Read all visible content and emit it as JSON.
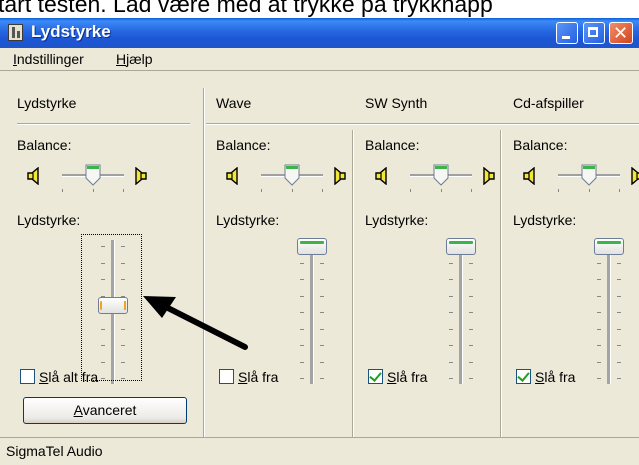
{
  "header_text": "tart testen. Lad være med at trykke på trykknapp",
  "window": {
    "title": "Lydstyrke",
    "controls": [
      "minimize",
      "maximize",
      "close"
    ]
  },
  "menu": {
    "items": [
      "Indstillinger",
      "Hjælp"
    ]
  },
  "master": {
    "header": "Lydstyrke",
    "balance_label": "Balance:",
    "volume_label": "Lydstyrke:",
    "mute_label": "Slå alt fra",
    "muted": false,
    "balance": 0.5,
    "volume": 0.6,
    "advanced_label": "Avanceret"
  },
  "channels": [
    {
      "name": "Wave",
      "balance_label": "Balance:",
      "volume_label": "Lydstyrke:",
      "mute_label": "Slå fra",
      "muted": false,
      "balance": 0.5,
      "volume": 1.0
    },
    {
      "name": "SW Synth",
      "balance_label": "Balance:",
      "volume_label": "Lydstyrke:",
      "mute_label": "Slå fra",
      "muted": true,
      "balance": 0.5,
      "volume": 1.0
    },
    {
      "name": "Cd-afspiller",
      "balance_label": "Balance:",
      "volume_label": "Lydstyrke:",
      "mute_label": "Slå fra",
      "muted": true,
      "balance": 0.5,
      "volume": 1.0
    }
  ],
  "status": {
    "text": "SigmaTel Audio"
  },
  "icons": {
    "left_speaker": "speaker-left-icon",
    "right_speaker": "speaker-right-icon",
    "annotation": "pointer-arrow"
  },
  "colors": {
    "titlebar": "#1d56d6",
    "close_button": "#d2431b",
    "thumb_accent": "#3cb44a",
    "focus_accent": "#f5a21d",
    "check": "#21a121"
  }
}
